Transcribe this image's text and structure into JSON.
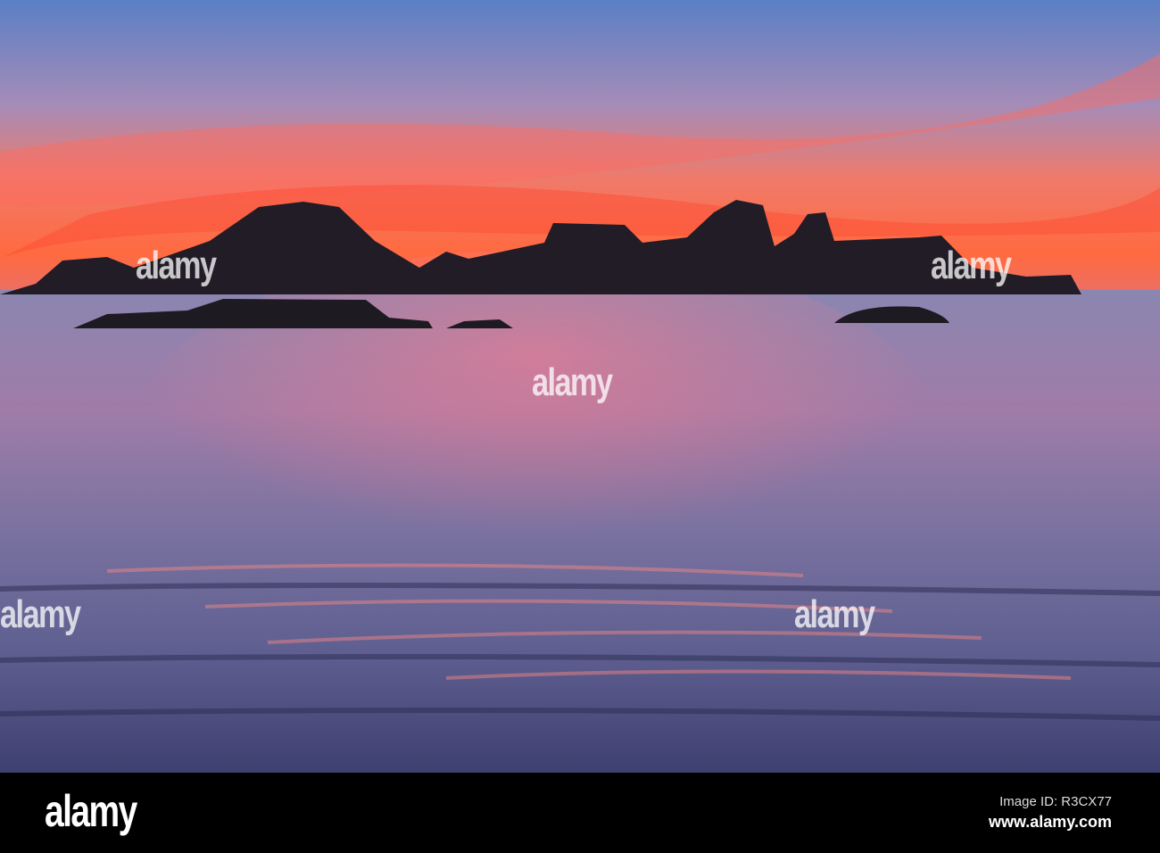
{
  "watermark": {
    "brand": "alamy"
  },
  "footer": {
    "logo": "alamy",
    "image_id": "Image ID: R3CX77",
    "website": "www.alamy.com"
  },
  "colors": {
    "sky_top": "#5a7fc0",
    "sunset_orange": "#ff5a3a",
    "rocks": "#221c26",
    "water": "#6a6a98"
  }
}
